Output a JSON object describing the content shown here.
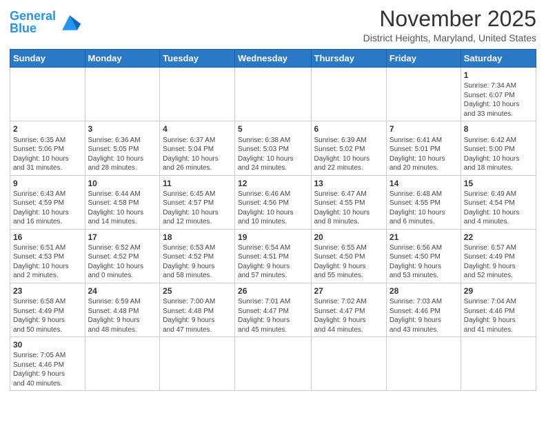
{
  "header": {
    "logo_text_regular": "General",
    "logo_text_blue": "Blue",
    "month_title": "November 2025",
    "location": "District Heights, Maryland, United States"
  },
  "weekdays": [
    "Sunday",
    "Monday",
    "Tuesday",
    "Wednesday",
    "Thursday",
    "Friday",
    "Saturday"
  ],
  "weeks": [
    [
      {
        "day": "",
        "info": ""
      },
      {
        "day": "",
        "info": ""
      },
      {
        "day": "",
        "info": ""
      },
      {
        "day": "",
        "info": ""
      },
      {
        "day": "",
        "info": ""
      },
      {
        "day": "",
        "info": ""
      },
      {
        "day": "1",
        "info": "Sunrise: 7:34 AM\nSunset: 6:07 PM\nDaylight: 10 hours\nand 33 minutes."
      }
    ],
    [
      {
        "day": "2",
        "info": "Sunrise: 6:35 AM\nSunset: 5:06 PM\nDaylight: 10 hours\nand 31 minutes."
      },
      {
        "day": "3",
        "info": "Sunrise: 6:36 AM\nSunset: 5:05 PM\nDaylight: 10 hours\nand 28 minutes."
      },
      {
        "day": "4",
        "info": "Sunrise: 6:37 AM\nSunset: 5:04 PM\nDaylight: 10 hours\nand 26 minutes."
      },
      {
        "day": "5",
        "info": "Sunrise: 6:38 AM\nSunset: 5:03 PM\nDaylight: 10 hours\nand 24 minutes."
      },
      {
        "day": "6",
        "info": "Sunrise: 6:39 AM\nSunset: 5:02 PM\nDaylight: 10 hours\nand 22 minutes."
      },
      {
        "day": "7",
        "info": "Sunrise: 6:41 AM\nSunset: 5:01 PM\nDaylight: 10 hours\nand 20 minutes."
      },
      {
        "day": "8",
        "info": "Sunrise: 6:42 AM\nSunset: 5:00 PM\nDaylight: 10 hours\nand 18 minutes."
      }
    ],
    [
      {
        "day": "9",
        "info": "Sunrise: 6:43 AM\nSunset: 4:59 PM\nDaylight: 10 hours\nand 16 minutes."
      },
      {
        "day": "10",
        "info": "Sunrise: 6:44 AM\nSunset: 4:58 PM\nDaylight: 10 hours\nand 14 minutes."
      },
      {
        "day": "11",
        "info": "Sunrise: 6:45 AM\nSunset: 4:57 PM\nDaylight: 10 hours\nand 12 minutes."
      },
      {
        "day": "12",
        "info": "Sunrise: 6:46 AM\nSunset: 4:56 PM\nDaylight: 10 hours\nand 10 minutes."
      },
      {
        "day": "13",
        "info": "Sunrise: 6:47 AM\nSunset: 4:55 PM\nDaylight: 10 hours\nand 8 minutes."
      },
      {
        "day": "14",
        "info": "Sunrise: 6:48 AM\nSunset: 4:55 PM\nDaylight: 10 hours\nand 6 minutes."
      },
      {
        "day": "15",
        "info": "Sunrise: 6:49 AM\nSunset: 4:54 PM\nDaylight: 10 hours\nand 4 minutes."
      }
    ],
    [
      {
        "day": "16",
        "info": "Sunrise: 6:51 AM\nSunset: 4:53 PM\nDaylight: 10 hours\nand 2 minutes."
      },
      {
        "day": "17",
        "info": "Sunrise: 6:52 AM\nSunset: 4:52 PM\nDaylight: 10 hours\nand 0 minutes."
      },
      {
        "day": "18",
        "info": "Sunrise: 6:53 AM\nSunset: 4:52 PM\nDaylight: 9 hours\nand 58 minutes."
      },
      {
        "day": "19",
        "info": "Sunrise: 6:54 AM\nSunset: 4:51 PM\nDaylight: 9 hours\nand 57 minutes."
      },
      {
        "day": "20",
        "info": "Sunrise: 6:55 AM\nSunset: 4:50 PM\nDaylight: 9 hours\nand 55 minutes."
      },
      {
        "day": "21",
        "info": "Sunrise: 6:56 AM\nSunset: 4:50 PM\nDaylight: 9 hours\nand 53 minutes."
      },
      {
        "day": "22",
        "info": "Sunrise: 6:57 AM\nSunset: 4:49 PM\nDaylight: 9 hours\nand 52 minutes."
      }
    ],
    [
      {
        "day": "23",
        "info": "Sunrise: 6:58 AM\nSunset: 4:49 PM\nDaylight: 9 hours\nand 50 minutes."
      },
      {
        "day": "24",
        "info": "Sunrise: 6:59 AM\nSunset: 4:48 PM\nDaylight: 9 hours\nand 48 minutes."
      },
      {
        "day": "25",
        "info": "Sunrise: 7:00 AM\nSunset: 4:48 PM\nDaylight: 9 hours\nand 47 minutes."
      },
      {
        "day": "26",
        "info": "Sunrise: 7:01 AM\nSunset: 4:47 PM\nDaylight: 9 hours\nand 45 minutes."
      },
      {
        "day": "27",
        "info": "Sunrise: 7:02 AM\nSunset: 4:47 PM\nDaylight: 9 hours\nand 44 minutes."
      },
      {
        "day": "28",
        "info": "Sunrise: 7:03 AM\nSunset: 4:46 PM\nDaylight: 9 hours\nand 43 minutes."
      },
      {
        "day": "29",
        "info": "Sunrise: 7:04 AM\nSunset: 4:46 PM\nDaylight: 9 hours\nand 41 minutes."
      }
    ],
    [
      {
        "day": "30",
        "info": "Sunrise: 7:05 AM\nSunset: 4:46 PM\nDaylight: 9 hours\nand 40 minutes."
      },
      {
        "day": "",
        "info": ""
      },
      {
        "day": "",
        "info": ""
      },
      {
        "day": "",
        "info": ""
      },
      {
        "day": "",
        "info": ""
      },
      {
        "day": "",
        "info": ""
      },
      {
        "day": "",
        "info": ""
      }
    ]
  ]
}
